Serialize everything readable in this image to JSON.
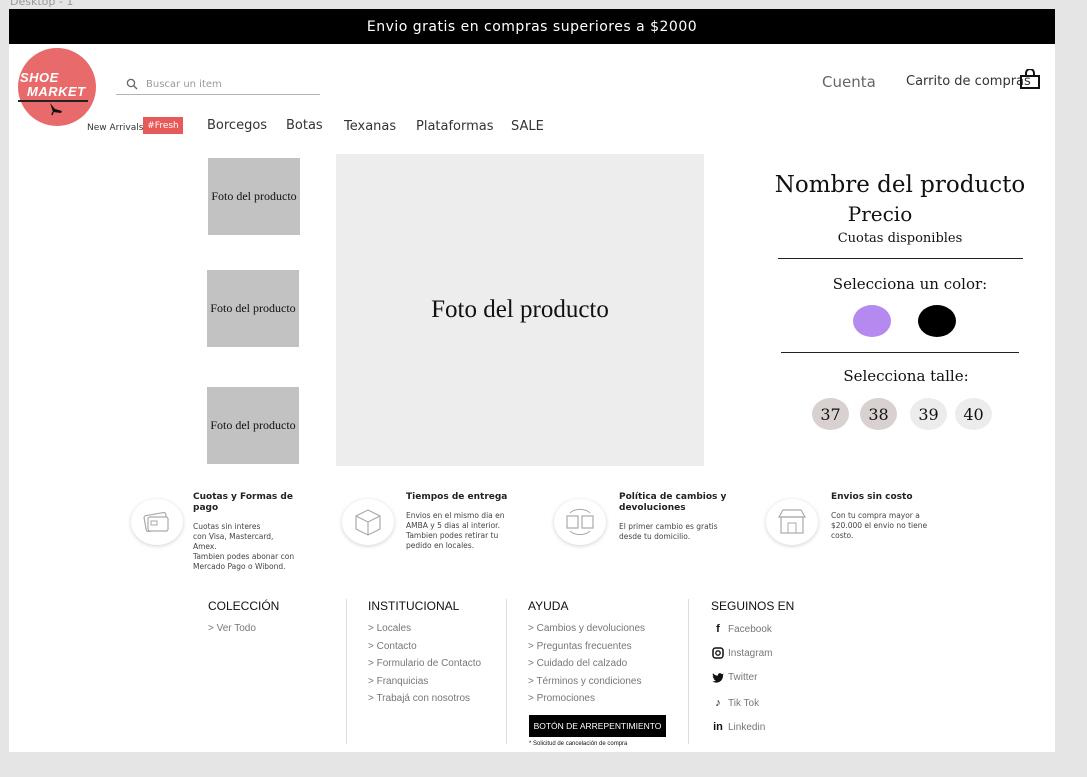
{
  "frame": {
    "label": "Desktop - 1"
  },
  "promo": {
    "text": "Envio gratis en compras superiores a $2000"
  },
  "brand": {
    "line1": "SHOE",
    "line2": "MARKET",
    "color": "#e86a6a"
  },
  "search": {
    "placeholder": "Buscar un item",
    "value": ""
  },
  "header": {
    "account": "Cuenta",
    "cart": "Carrito de compras"
  },
  "nav": {
    "new_arrivals": "New Arrivals",
    "fresh_badge": "#Fresh",
    "items": [
      "Borcegos",
      "Botas",
      "Texanas",
      "Plataformas",
      "SALE"
    ]
  },
  "gallery": {
    "thumbs": [
      "Foto del producto",
      "Foto del producto",
      "Foto del producto"
    ],
    "main": "Foto del producto"
  },
  "product": {
    "name": "Nombre del producto",
    "price": "Precio",
    "installments": "Cuotas disponibles",
    "color_title": "Selecciona un color:",
    "colors": [
      {
        "name": "lila",
        "hex": "#b489f0"
      },
      {
        "name": "negro",
        "hex": "#000000"
      }
    ],
    "size_title": "Selecciona talle:",
    "sizes": [
      "37",
      "38",
      "39",
      "40"
    ]
  },
  "features": [
    {
      "icon": "credit-card-icon",
      "title": "Cuotas y Formas de pago",
      "text": "Cuotas sin interes\ncon Visa, Mastercard,\nAmex.\nTambien podes abonar con\nMercado Pago o Wibond."
    },
    {
      "icon": "box-icon",
      "title": "Tiempos de entrega",
      "text": "Envios en el mismo dia en\nAMBA y 5 dias al interior.\nTambien podes retirar tu\npedido en locales."
    },
    {
      "icon": "exchange-icon",
      "title": "Política de cambios y devoluciones",
      "text": "El primer cambio es gratis\ndesde tu domicilio."
    },
    {
      "icon": "store-icon",
      "title": "Envios sin costo",
      "text": "Con tu compra mayor a\n$20.000 el envio no tiene\ncosto."
    }
  ],
  "footer": {
    "coleccion": {
      "title": "COLECCIÓN",
      "links": [
        "> Ver Todo"
      ]
    },
    "institucional": {
      "title": "INSTITUCIONAL",
      "links": [
        "> Locales",
        "> Contacto",
        "> Formulario de Contacto",
        "> Franquicias",
        "> Trabajá con nosotros"
      ]
    },
    "ayuda": {
      "title": "AYUDA",
      "links": [
        "> Cambios y devoluciones",
        "> Preguntas frecuentes",
        "> Cuidado del calzado",
        "> Términos y condiciones",
        "> Promociones"
      ],
      "regret_button": "BOTÓN DE ARREPENTIMIENTO",
      "regret_note": "* Solicitud de cancelación de compra"
    },
    "social": {
      "title": "SEGUINOS EN",
      "items": [
        {
          "icon": "facebook-icon",
          "label": "Facebook"
        },
        {
          "icon": "instagram-icon",
          "label": "Instagram"
        },
        {
          "icon": "twitter-icon",
          "label": "Twitter"
        },
        {
          "icon": "tiktok-icon",
          "label": "Tik Tok"
        },
        {
          "icon": "linkedin-icon",
          "label": "Linkedin"
        }
      ]
    }
  }
}
